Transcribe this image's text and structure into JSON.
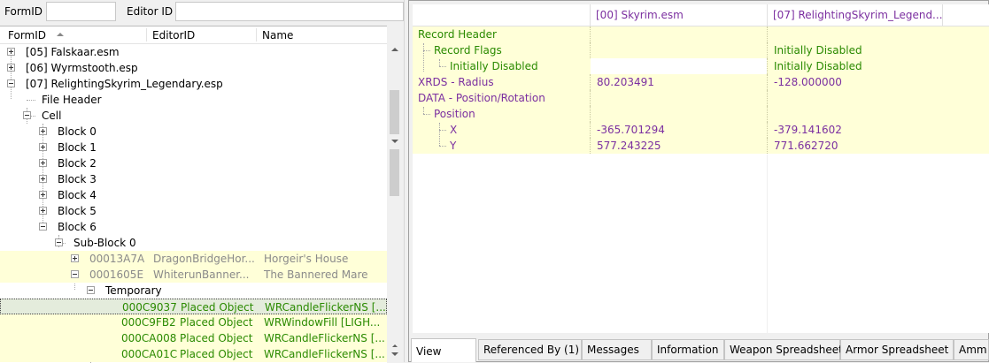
{
  "filters": {
    "formid_label": "FormID",
    "editorid_label": "Editor ID"
  },
  "tree": {
    "headers": [
      "FormID",
      "EditorID",
      "Name"
    ],
    "rows": [
      {
        "text": "[05] Falskaar.esm"
      },
      {
        "text": "[06] Wyrmstooth.esp"
      },
      {
        "text": "[07] RelightingSkyrim_Legendary.esp"
      },
      {
        "text": "File Header"
      },
      {
        "text": "Cell"
      },
      {
        "text": "Block 0"
      },
      {
        "text": "Block 1"
      },
      {
        "text": "Block 2"
      },
      {
        "text": "Block 3"
      },
      {
        "text": "Block 4"
      },
      {
        "text": "Block 5"
      },
      {
        "text": "Block 6"
      },
      {
        "text": "Sub-Block 0"
      },
      {
        "formid": "00013A7A",
        "editorid": "DragonBridgeHor...",
        "name": "Horgeir's House"
      },
      {
        "formid": "0001605E",
        "editorid": "WhiterunBanner...",
        "name": "The Bannered Mare"
      },
      {
        "text": "Temporary"
      },
      {
        "formid": "000C9037",
        "editorid": "Placed Object",
        "name": "WRCandleFlickerNS [..."
      },
      {
        "formid": "000C9FB2",
        "editorid": "Placed Object",
        "name": "WRWindowFill [LIGH..."
      },
      {
        "formid": "000CA008",
        "editorid": "Placed Object",
        "name": "WRCandleFlickerNS [..."
      },
      {
        "formid": "000CA01C",
        "editorid": "Placed Object",
        "name": "WRCandleFlickerNS [..."
      }
    ]
  },
  "grid": {
    "col1": "[00] Skyrim.esm",
    "col2": "[07] RelightingSkyrim_Legend...",
    "rows": [
      {
        "label": "Record Header",
        "v1": "",
        "v2": ""
      },
      {
        "label": "Record Flags",
        "v1": "",
        "v2": "Initially Disabled"
      },
      {
        "label": "Initially Disabled",
        "v1": "",
        "v2": "Initially Disabled"
      },
      {
        "label": "XRDS - Radius",
        "v1": "80.203491",
        "v2": "-128.000000"
      },
      {
        "label": "DATA - Position/Rotation",
        "v1": "",
        "v2": ""
      },
      {
        "label": "Position",
        "v1": "",
        "v2": ""
      },
      {
        "label": "X",
        "v1": "-365.701294",
        "v2": "-379.141602"
      },
      {
        "label": "Y",
        "v1": "577.243225",
        "v2": "771.662720"
      }
    ]
  },
  "tabs": [
    "View",
    "Referenced By (1)",
    "Messages",
    "Information",
    "Weapon Spreadsheet",
    "Armor Spreadsheet",
    "Amm"
  ],
  "colors": {
    "purple": "#7b2fa0",
    "green": "#2a8a00",
    "highlight": "#ffffd8"
  }
}
